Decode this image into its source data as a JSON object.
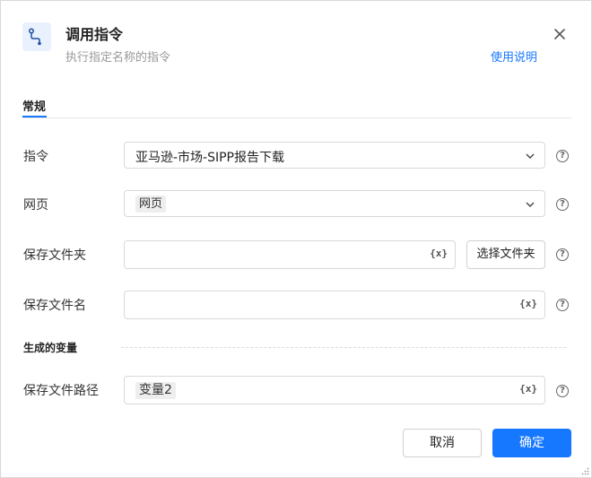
{
  "dialog": {
    "title": "调用指令",
    "subtitle": "执行指定名称的指令",
    "help_link": "使用说明",
    "icon": "flow-route-icon",
    "close_icon": "close-icon"
  },
  "tabs": [
    {
      "label": "常规",
      "active": true
    }
  ],
  "fields": {
    "command": {
      "label": "指令",
      "value": "亚马逊-市场-SIPP报告下载"
    },
    "webpage": {
      "label": "网页",
      "tag": "网页"
    },
    "save_folder": {
      "label": "保存文件夹",
      "value": "",
      "var_symbol": "{x}",
      "pick_button": "选择文件夹"
    },
    "save_filename": {
      "label": "保存文件名",
      "value": "",
      "var_symbol": "{x}"
    }
  },
  "generated_vars": {
    "section_label": "生成的变量",
    "save_path": {
      "label": "保存文件路径",
      "tag": "变量2",
      "var_symbol": "{x}"
    }
  },
  "help_symbol": "?",
  "footer": {
    "cancel_label": "取消",
    "ok_label": "确定"
  },
  "colors": {
    "accent": "#1677ff",
    "icon_bg": "#e9f0fe"
  }
}
